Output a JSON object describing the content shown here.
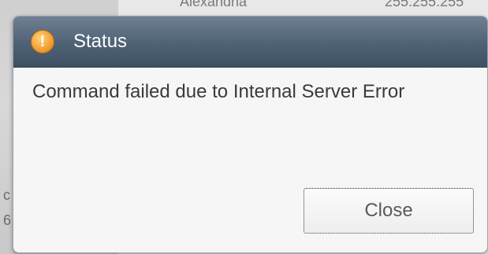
{
  "background": {
    "top_left_text": "Alexandria",
    "top_right_text": "255.255.255",
    "side_text_1": "c",
    "side_text_2": "6"
  },
  "dialog": {
    "icon": "warning-exclamation-icon",
    "icon_glyph": "!",
    "title": "Status",
    "message": "Command failed due to Internal Server Error",
    "close_label": "Close"
  },
  "colors": {
    "header": "#4f6175",
    "icon": "#f3a23a",
    "body": "#f6f6f6"
  }
}
